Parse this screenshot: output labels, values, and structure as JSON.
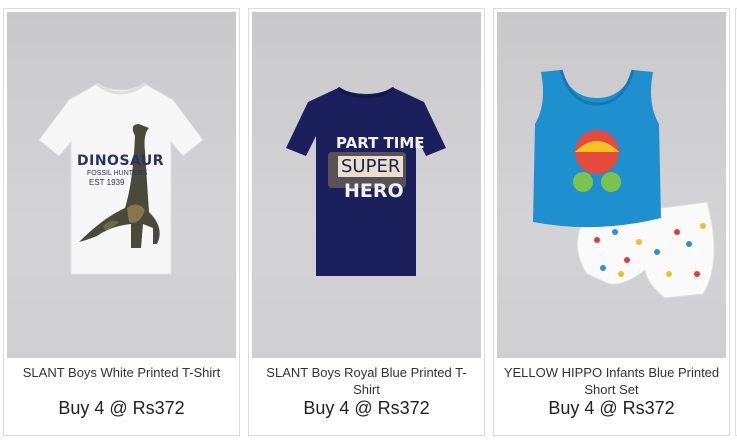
{
  "products": [
    {
      "name": "SLANT Boys White Printed T-Shirt",
      "offer": "Buy 4 @ Rs372",
      "print": {
        "line1": "DINOSAUR",
        "line2": "FOSSIL HUNTERS",
        "line3": "EST 1939"
      }
    },
    {
      "name": "SLANT Boys Royal Blue Printed T-Shirt",
      "offer": "Buy 4 @ Rs372",
      "print": {
        "line1": "PART TIME",
        "line2": "SUPER",
        "line3": "HERO"
      }
    },
    {
      "name": "YELLOW HIPPO Infants Blue Printed Short Set",
      "offer": "Buy 4 @ Rs372"
    }
  ],
  "colors": {
    "page_bg": "#ffffff",
    "card_border": "#dcdcdc",
    "photo_bg": "#cfcfd1",
    "navy_tee": "#1b1f5c",
    "infant_top": "#1e8fcf"
  }
}
